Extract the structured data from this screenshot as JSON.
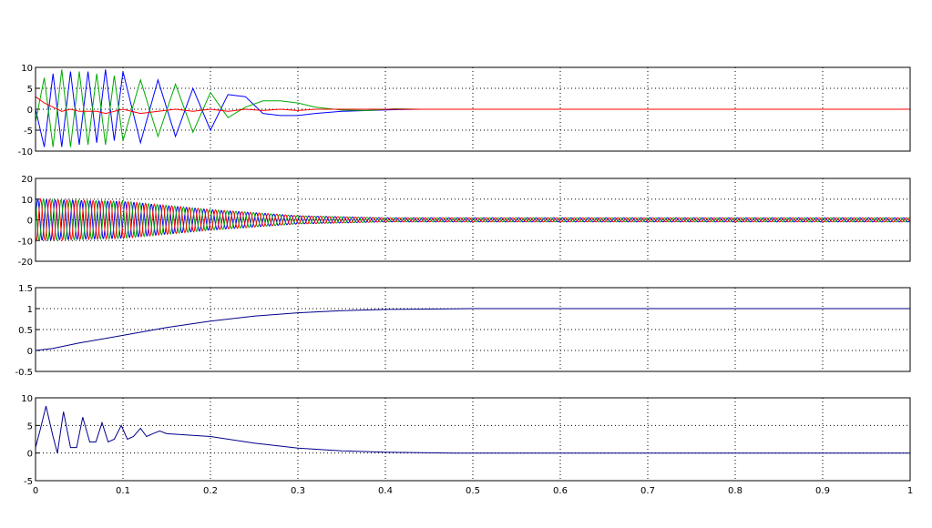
{
  "chart_data": [
    {
      "type": "line",
      "title": "",
      "xlabel": "",
      "ylabel": "",
      "xlim": [
        0,
        1
      ],
      "ylim": [
        -10,
        10
      ],
      "grid": true,
      "y_ticks": [
        "10",
        "5",
        "0",
        "-5",
        "-10"
      ],
      "x_ticks": [],
      "series": [
        {
          "color": "#0000ff",
          "x": [
            0,
            0.01,
            0.02,
            0.03,
            0.04,
            0.05,
            0.06,
            0.07,
            0.08,
            0.09,
            0.1,
            0.12,
            0.14,
            0.16,
            0.18,
            0.2,
            0.22,
            0.24,
            0.26,
            0.28,
            0.3,
            0.32,
            0.35,
            0.38,
            0.41,
            0.44,
            0.47,
            0.48,
            0.6,
            0.8,
            1.0
          ],
          "y": [
            0,
            -9.0,
            8.5,
            -9.0,
            9.0,
            -8.5,
            9.0,
            -8.0,
            9.5,
            -7.5,
            9.0,
            -8.0,
            7.0,
            -6.5,
            5.0,
            -5.0,
            3.5,
            3.0,
            -1.0,
            -1.5,
            -1.5,
            -1.0,
            -0.5,
            -0.3,
            -0.1,
            0,
            0,
            0,
            0,
            0,
            0
          ]
        },
        {
          "color": "#00aa00",
          "x": [
            0,
            0.01,
            0.02,
            0.03,
            0.04,
            0.05,
            0.06,
            0.07,
            0.08,
            0.09,
            0.1,
            0.12,
            0.14,
            0.16,
            0.18,
            0.2,
            0.22,
            0.24,
            0.26,
            0.28,
            0.3,
            0.32,
            0.35,
            0.38,
            0.41,
            0.44,
            0.47,
            0.48,
            0.6,
            0.8,
            1.0
          ],
          "y": [
            -3.0,
            7.5,
            -9.0,
            9.5,
            -9.0,
            9.0,
            -8.5,
            8.5,
            -8.5,
            8.0,
            -7.5,
            7.0,
            -6.5,
            6.0,
            -5.5,
            4.0,
            -2.0,
            0.5,
            2.0,
            2.0,
            1.5,
            0.5,
            -0.2,
            -0.3,
            0.1,
            0,
            0,
            0,
            0,
            0,
            0
          ]
        },
        {
          "color": "#ff0000",
          "x": [
            0,
            0.01,
            0.02,
            0.03,
            0.04,
            0.05,
            0.06,
            0.07,
            0.08,
            0.09,
            0.1,
            0.12,
            0.14,
            0.16,
            0.18,
            0.2,
            0.22,
            0.24,
            0.26,
            0.28,
            0.3,
            0.32,
            0.35,
            0.38,
            0.41,
            0.44,
            0.47,
            0.48,
            0.6,
            0.8,
            1.0
          ],
          "y": [
            3.0,
            1.5,
            0.5,
            -0.5,
            0,
            -0.5,
            -0.5,
            -0.5,
            -1.0,
            -0.5,
            0,
            -1.0,
            -0.5,
            0,
            -0.5,
            0,
            -0.5,
            0,
            -0.3,
            0,
            -0.3,
            0,
            0,
            0,
            0,
            0,
            0,
            0,
            0,
            0,
            0
          ]
        }
      ]
    },
    {
      "type": "line",
      "title": "",
      "xlabel": "",
      "ylabel": "",
      "xlim": [
        0,
        1
      ],
      "ylim": [
        -20,
        20
      ],
      "grid": true,
      "y_ticks": [
        "20",
        "10",
        "0",
        "-10",
        "-20"
      ],
      "x_ticks": [],
      "series": [
        {
          "color": "#0000ff",
          "x": [
            0,
            0.1,
            0.2,
            0.3,
            0.4,
            1.0
          ],
          "y": [
            10,
            9,
            5,
            2,
            1,
            1
          ]
        },
        {
          "color": "#00aa00",
          "x": [
            0,
            0.1,
            0.2,
            0.3,
            0.4,
            1.0
          ],
          "y": [
            10,
            9,
            5,
            2,
            1,
            1
          ]
        },
        {
          "color": "#ff0000",
          "x": [
            0,
            0.1,
            0.2,
            0.3,
            0.4,
            1.0
          ],
          "y": [
            10,
            9,
            5,
            2,
            1,
            1
          ]
        }
      ]
    },
    {
      "type": "line",
      "title": "",
      "xlabel": "",
      "ylabel": "",
      "xlim": [
        0,
        1
      ],
      "ylim": [
        -0.5,
        1.5
      ],
      "grid": true,
      "y_ticks": [
        "1.5",
        "1",
        "0.5",
        "0",
        "-0.5"
      ],
      "x_ticks": [],
      "series": [
        {
          "color": "#00008b",
          "x": [
            0,
            0.02,
            0.05,
            0.1,
            0.15,
            0.2,
            0.25,
            0.3,
            0.35,
            0.4,
            0.45,
            0.5,
            0.6,
            0.8,
            1.0
          ],
          "y": [
            0,
            0.05,
            0.18,
            0.36,
            0.55,
            0.7,
            0.82,
            0.9,
            0.95,
            0.98,
            0.99,
            1.0,
            1.0,
            1.0,
            1.0
          ]
        }
      ]
    },
    {
      "type": "line",
      "title": "",
      "xlabel": "",
      "ylabel": "",
      "xlim": [
        0,
        1
      ],
      "ylim": [
        -5,
        10
      ],
      "grid": true,
      "y_ticks": [
        "10",
        "5",
        "0",
        "-5"
      ],
      "x_ticks": [
        "0",
        "0.1",
        "0.2",
        "0.3",
        "0.4",
        "0.5",
        "0.6",
        "0.7",
        "0.8",
        "0.9",
        "1"
      ],
      "series": [
        {
          "color": "#00008b",
          "x": [
            0,
            0.005,
            0.012,
            0.02,
            0.025,
            0.032,
            0.04,
            0.047,
            0.054,
            0.062,
            0.069,
            0.076,
            0.083,
            0.09,
            0.098,
            0.105,
            0.112,
            0.12,
            0.127,
            0.134,
            0.142,
            0.15,
            0.17,
            0.2,
            0.25,
            0.3,
            0.35,
            0.4,
            0.45,
            0.48,
            0.6,
            0.8,
            1.0
          ],
          "y": [
            1.0,
            4.0,
            8.5,
            3.0,
            0,
            7.5,
            1.0,
            1.0,
            6.5,
            2.0,
            2.0,
            5.5,
            2.0,
            2.5,
            5.0,
            2.5,
            3.0,
            4.5,
            3.0,
            3.5,
            4.0,
            3.5,
            3.3,
            3.0,
            1.8,
            0.9,
            0.4,
            0.15,
            0.05,
            0,
            0,
            0,
            0
          ]
        }
      ]
    }
  ]
}
